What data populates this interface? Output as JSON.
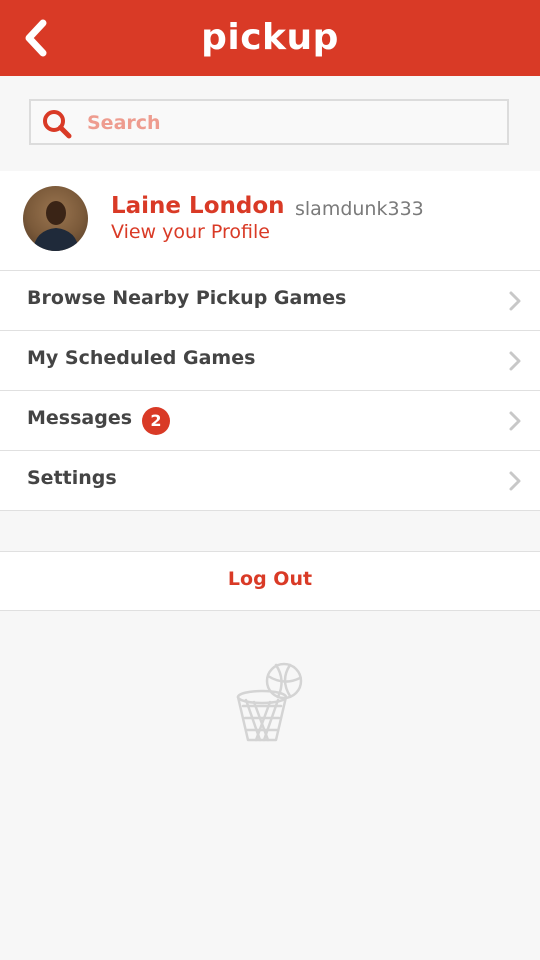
{
  "header": {
    "title": "pickup",
    "back_icon": "chevron-left-icon",
    "background_color": "#d93a26"
  },
  "search": {
    "placeholder": "Search",
    "value": "",
    "icon": "search-icon"
  },
  "profile": {
    "name": "Laine London",
    "username": "slamdunk333",
    "link_text": "View your Profile"
  },
  "menu": {
    "items": [
      {
        "label": "Browse Nearby Pickup Games",
        "badge": ""
      },
      {
        "label": "My Scheduled Games",
        "badge": ""
      },
      {
        "label": "Messages",
        "badge": "2"
      },
      {
        "label": "Settings",
        "badge": ""
      }
    ]
  },
  "logout": {
    "label": "Log Out"
  },
  "footer": {
    "logo_icon": "basketball-hoop-icon"
  },
  "colors": {
    "accent": "#d93a26",
    "background": "#f7f7f7",
    "text_primary": "#444444",
    "text_secondary": "#7a7a7a",
    "placeholder": "#ee9c8f"
  }
}
